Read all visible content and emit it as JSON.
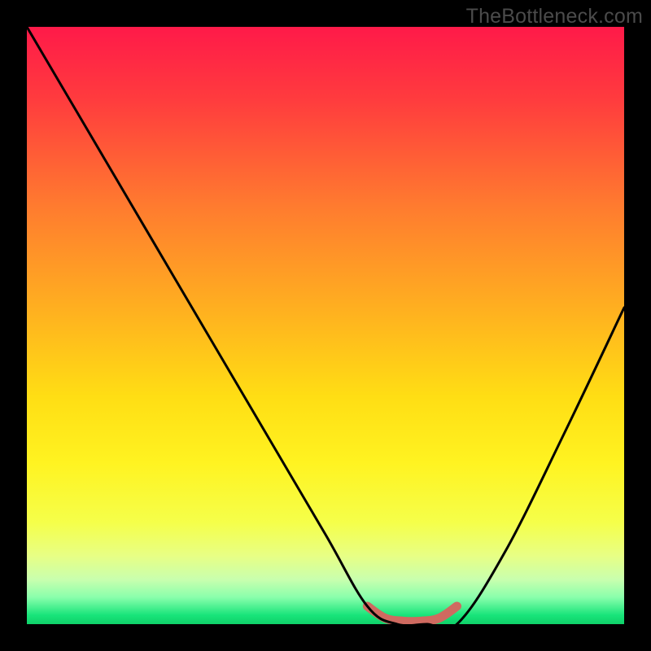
{
  "watermark": "TheBottleneck.com",
  "chart_data": {
    "type": "line",
    "title": "",
    "xlabel": "",
    "ylabel": "",
    "xlim": [
      0,
      100
    ],
    "ylim": [
      0,
      100
    ],
    "annotations": [],
    "series": [
      {
        "name": "bottleneck-curve",
        "x": [
          0,
          10,
          20,
          30,
          40,
          50,
          57,
          62,
          67,
          72,
          80,
          90,
          100
        ],
        "y": [
          100,
          83,
          66,
          49,
          32,
          15,
          3,
          0,
          0,
          0,
          12,
          32,
          53
        ]
      }
    ],
    "highlight_segment": {
      "name": "optimal-range",
      "x": [
        57,
        60,
        63,
        66,
        69,
        72
      ],
      "y": [
        3,
        1,
        0.5,
        0.5,
        1,
        3
      ]
    },
    "gradient_stops": [
      {
        "offset": 0.0,
        "color": "#ff1a49"
      },
      {
        "offset": 0.12,
        "color": "#ff3b3e"
      },
      {
        "offset": 0.3,
        "color": "#ff7b2f"
      },
      {
        "offset": 0.48,
        "color": "#ffb21f"
      },
      {
        "offset": 0.62,
        "color": "#ffde14"
      },
      {
        "offset": 0.73,
        "color": "#fff321"
      },
      {
        "offset": 0.83,
        "color": "#f5ff4a"
      },
      {
        "offset": 0.885,
        "color": "#e8ff84"
      },
      {
        "offset": 0.925,
        "color": "#c9ffae"
      },
      {
        "offset": 0.955,
        "color": "#8affac"
      },
      {
        "offset": 0.985,
        "color": "#18e47a"
      },
      {
        "offset": 1.0,
        "color": "#0fd169"
      }
    ]
  },
  "style": {
    "curve_stroke": "#000000",
    "curve_width": 3,
    "highlight_stroke": "#cf6a60",
    "highlight_width": 11,
    "plot_size": 734,
    "frame_border": 33
  }
}
